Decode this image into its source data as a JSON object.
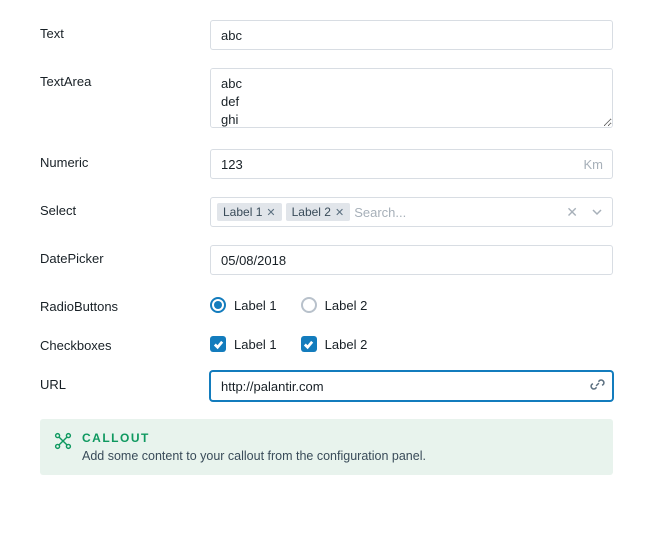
{
  "fields": {
    "text": {
      "label": "Text",
      "value": "abc"
    },
    "textarea": {
      "label": "TextArea",
      "value": "abc\ndef\nghi"
    },
    "numeric": {
      "label": "Numeric",
      "value": "123",
      "unit": "Km"
    },
    "select": {
      "label": "Select",
      "tags": [
        "Label 1",
        "Label 2"
      ],
      "placeholder": "Search..."
    },
    "datepicker": {
      "label": "DatePicker",
      "value": "05/08/2018"
    },
    "radio": {
      "label": "RadioButtons",
      "options": [
        {
          "label": "Label 1",
          "checked": true
        },
        {
          "label": "Label 2",
          "checked": false
        }
      ]
    },
    "checkboxes": {
      "label": "Checkboxes",
      "options": [
        {
          "label": "Label 1",
          "checked": true
        },
        {
          "label": "Label 2",
          "checked": true
        }
      ]
    },
    "url": {
      "label": "URL",
      "value": "http://palantir.com"
    }
  },
  "callout": {
    "title": "CALLOUT",
    "text": "Add some content to your callout from the configuration panel."
  }
}
